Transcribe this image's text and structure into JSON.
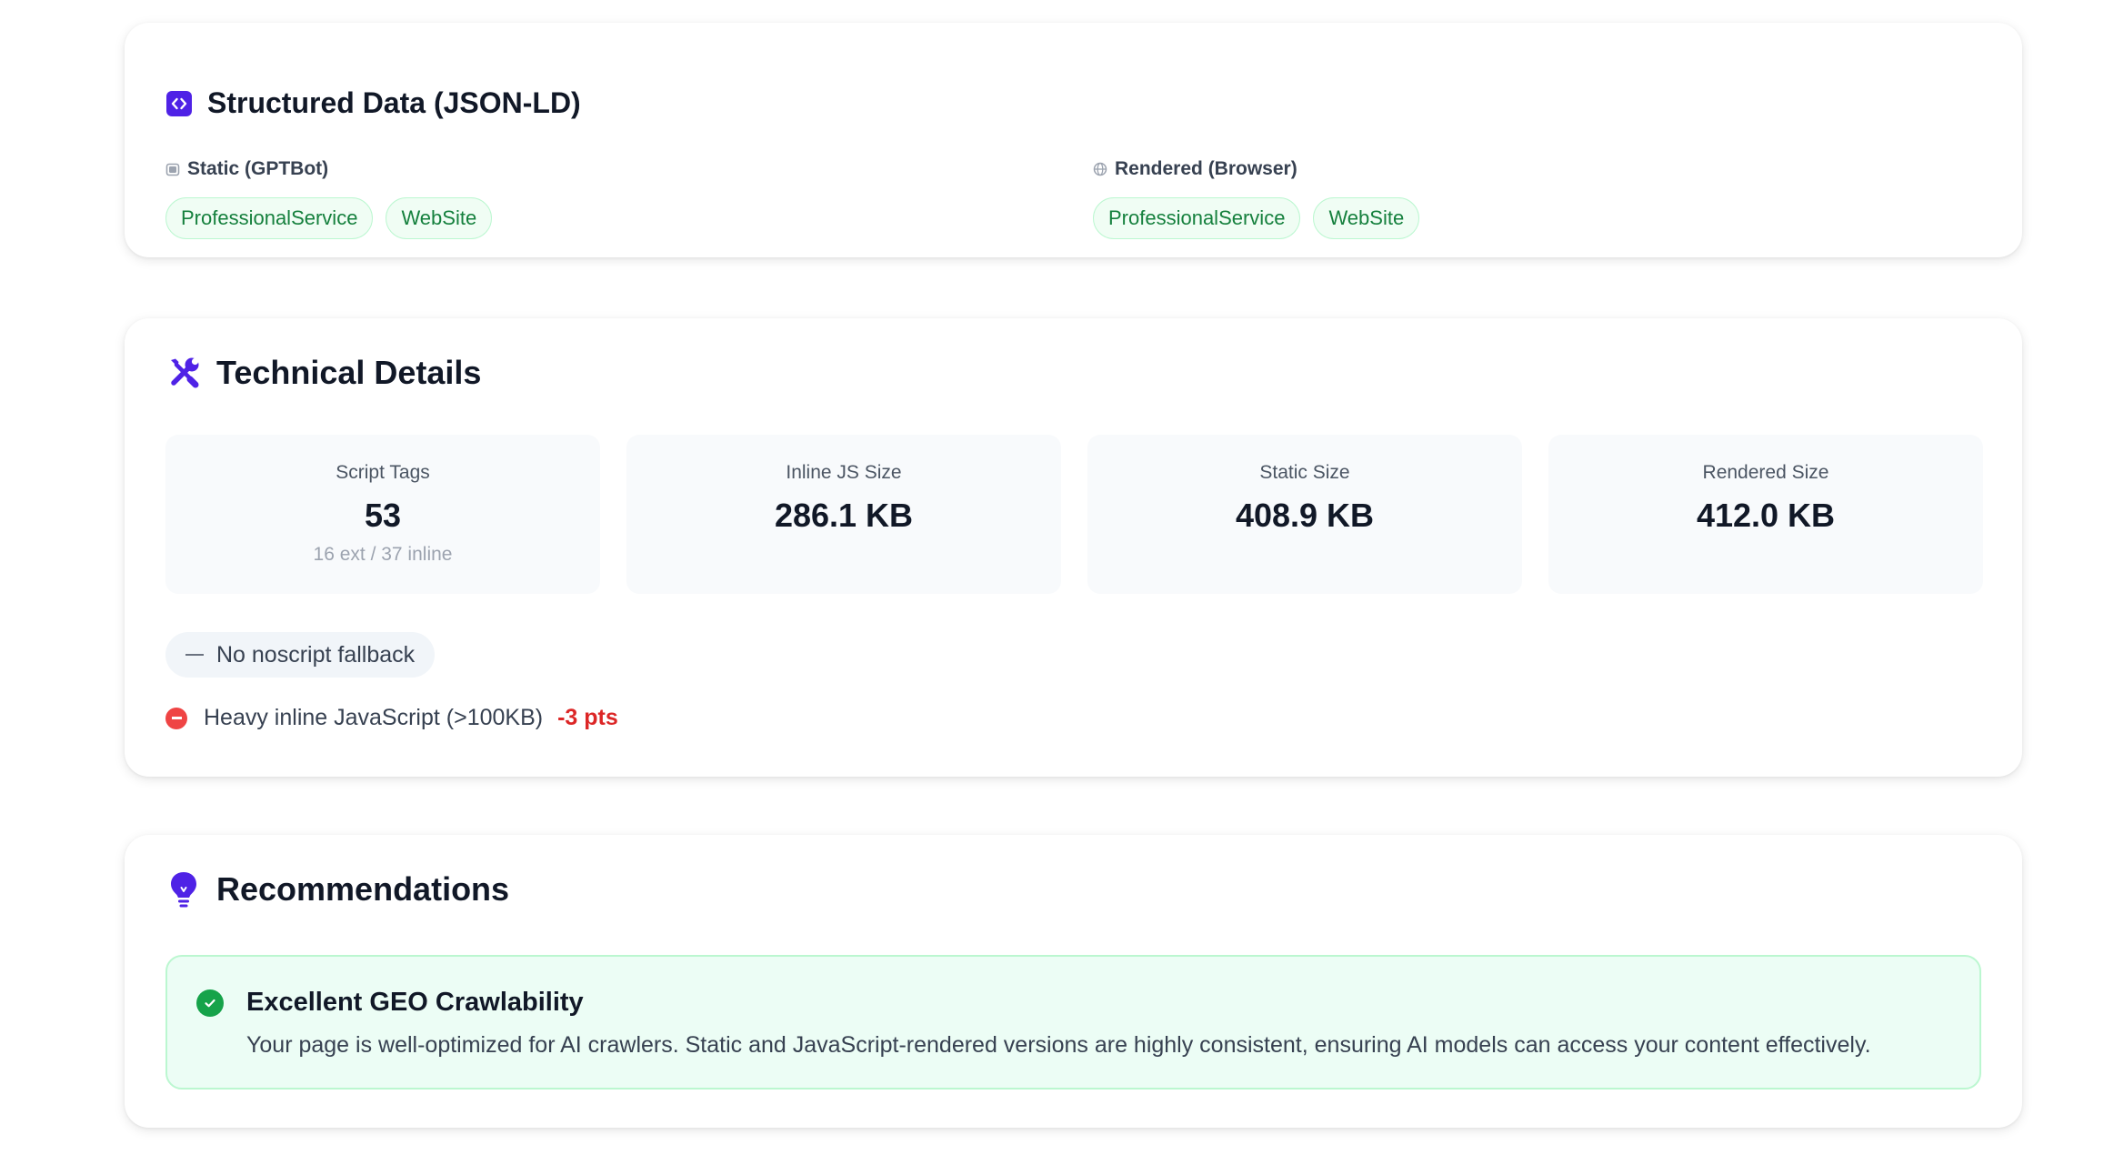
{
  "structured_data": {
    "title": "Structured Data (JSON-LD)",
    "icon": "code-icon",
    "static": {
      "label": "Static (GPTBot)",
      "icon": "bot-icon",
      "tags": [
        "ProfessionalService",
        "WebSite"
      ]
    },
    "rendered": {
      "label": "Rendered (Browser)",
      "icon": "globe-icon",
      "tags": [
        "ProfessionalService",
        "WebSite"
      ]
    }
  },
  "technical": {
    "title": "Technical Details",
    "icon": "wrench-screwdriver-icon",
    "metrics": [
      {
        "label": "Script Tags",
        "value": "53",
        "sub": "16 ext / 37 inline"
      },
      {
        "label": "Inline JS Size",
        "value": "286.1 KB",
        "sub": ""
      },
      {
        "label": "Static Size",
        "value": "408.9 KB",
        "sub": ""
      },
      {
        "label": "Rendered Size",
        "value": "412.0 KB",
        "sub": ""
      }
    ],
    "noscript": "No noscript fallback",
    "penalty": {
      "text": "Heavy inline JavaScript (>100KB)",
      "points": "-3 pts"
    }
  },
  "recommendations": {
    "title": "Recommendations",
    "icon": "lightbulb-icon",
    "item": {
      "title": "Excellent GEO Crawlability",
      "text": "Your page is well-optimized for AI crawlers. Static and JavaScript-rendered versions are highly consistent, ensuring AI models can access your content effectively."
    }
  },
  "colors": {
    "accent": "#4f22e6",
    "success": "#16a34a",
    "danger": "#dc2626"
  }
}
